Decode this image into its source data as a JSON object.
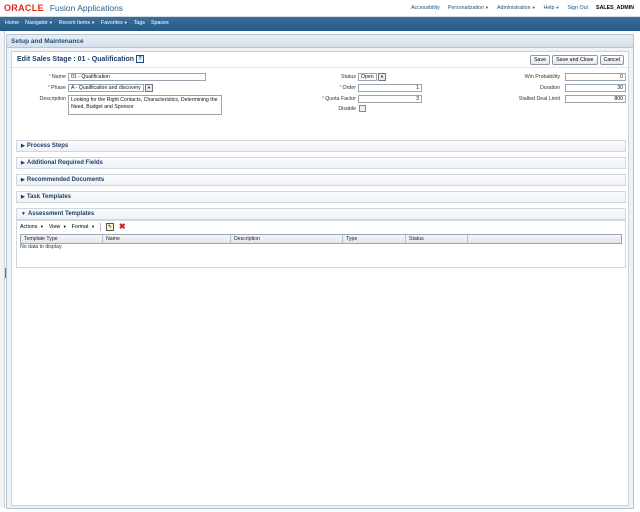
{
  "header": {
    "brand": "ORACLE",
    "app_name": "Fusion Applications",
    "links": [
      "Accessibility",
      "Personalization",
      "Administration",
      "Help",
      "Sign Out"
    ],
    "username": "SALES_ADMIN"
  },
  "nav": {
    "items": [
      "Home",
      "Navigator",
      "Recent Items",
      "Favorites",
      "Tags",
      "Spaces"
    ]
  },
  "region": {
    "title": "Setup and Maintenance"
  },
  "page": {
    "title": "Edit Sales Stage : 01 - Qualification",
    "help_glyph": "?",
    "buttons": [
      "Save",
      "Save and Close",
      "Cancel"
    ]
  },
  "form": {
    "name_label": "Name",
    "name_value": "01 - Qualification",
    "phase_label": "Phase",
    "phase_value": "A - Qualification and discovery",
    "description_label": "Description",
    "description_value": "Looking for the Right Contacts, Characteristics, Determining the Need, Budget and Sponsor",
    "status_label": "Status",
    "status_value": "Open",
    "order_label": "Order",
    "order_value": "1",
    "quota_label": "Quota Factor",
    "quota_value": "3",
    "disable_label": "Disable",
    "win_prob_label": "Win Probability",
    "win_prob_value": "0",
    "duration_label": "Duration",
    "duration_value": "30",
    "stalled_label": "Stalled Deal Limit",
    "stalled_value": "800"
  },
  "sections": [
    "Process Steps",
    "Additional Required Fields",
    "Recommended Documents",
    "Task Templates",
    "Assessment Templates"
  ],
  "assessment": {
    "toolbar": [
      "Actions",
      "View",
      "Format"
    ],
    "columns": [
      "Template Type",
      "Name",
      "Description",
      "Type",
      "Status"
    ],
    "empty_text": "No data to display."
  }
}
